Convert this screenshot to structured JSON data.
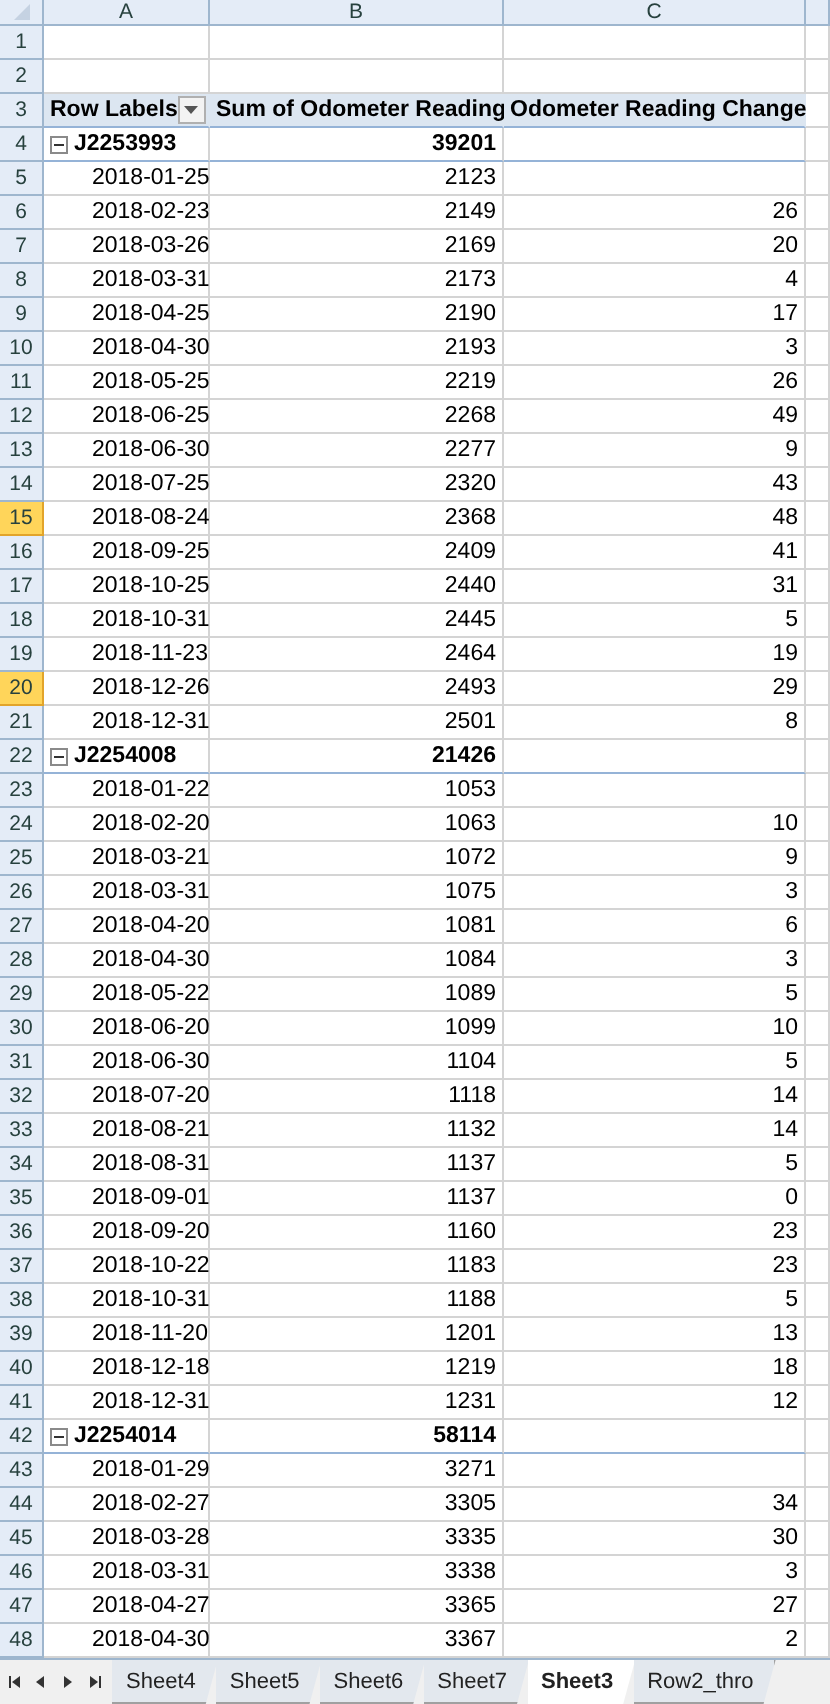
{
  "columns": [
    {
      "label": "A",
      "selected": false
    },
    {
      "label": "B",
      "selected": false
    },
    {
      "label": "C",
      "selected": false
    }
  ],
  "rows": [
    {
      "number": "1",
      "selected": false,
      "kind": "blank"
    },
    {
      "number": "2",
      "selected": false,
      "kind": "blank"
    },
    {
      "number": "3",
      "selected": false,
      "kind": "header",
      "cells": [
        "Row Labels",
        "Sum of Odometer Reading",
        "Odometer Reading Change"
      ]
    },
    {
      "number": "4",
      "selected": false,
      "kind": "group",
      "label": "J2253993",
      "sum": "39201",
      "expanded": true
    },
    {
      "number": "5",
      "selected": false,
      "kind": "item",
      "label": "2018-01-25",
      "sum": "2123"
    },
    {
      "number": "6",
      "selected": false,
      "kind": "item",
      "label": "2018-02-23",
      "sum": "2149",
      "change": "26"
    },
    {
      "number": "7",
      "selected": false,
      "kind": "item",
      "label": "2018-03-26",
      "sum": "2169",
      "change": "20"
    },
    {
      "number": "8",
      "selected": false,
      "kind": "item",
      "label": "2018-03-31",
      "sum": "2173",
      "change": "4"
    },
    {
      "number": "9",
      "selected": false,
      "kind": "item",
      "label": "2018-04-25",
      "sum": "2190",
      "change": "17"
    },
    {
      "number": "10",
      "selected": false,
      "kind": "item",
      "label": "2018-04-30",
      "sum": "2193",
      "change": "3"
    },
    {
      "number": "11",
      "selected": false,
      "kind": "item",
      "label": "2018-05-25",
      "sum": "2219",
      "change": "26"
    },
    {
      "number": "12",
      "selected": false,
      "kind": "item",
      "label": "2018-06-25",
      "sum": "2268",
      "change": "49"
    },
    {
      "number": "13",
      "selected": false,
      "kind": "item",
      "label": "2018-06-30",
      "sum": "2277",
      "change": "9"
    },
    {
      "number": "14",
      "selected": false,
      "kind": "item",
      "label": "2018-07-25",
      "sum": "2320",
      "change": "43"
    },
    {
      "number": "15",
      "selected": true,
      "kind": "item",
      "label": "2018-08-24",
      "sum": "2368",
      "change": "48"
    },
    {
      "number": "16",
      "selected": false,
      "kind": "item",
      "label": "2018-09-25",
      "sum": "2409",
      "change": "41"
    },
    {
      "number": "17",
      "selected": false,
      "kind": "item",
      "label": "2018-10-25",
      "sum": "2440",
      "change": "31"
    },
    {
      "number": "18",
      "selected": false,
      "kind": "item",
      "label": "2018-10-31",
      "sum": "2445",
      "change": "5"
    },
    {
      "number": "19",
      "selected": false,
      "kind": "item",
      "label": "2018-11-23",
      "sum": "2464",
      "change": "19"
    },
    {
      "number": "20",
      "selected": true,
      "kind": "item",
      "label": "2018-12-26",
      "sum": "2493",
      "change": "29"
    },
    {
      "number": "21",
      "selected": false,
      "kind": "item",
      "label": "2018-12-31",
      "sum": "2501",
      "change": "8"
    },
    {
      "number": "22",
      "selected": false,
      "kind": "group",
      "label": "J2254008",
      "sum": "21426",
      "expanded": true
    },
    {
      "number": "23",
      "selected": false,
      "kind": "item",
      "label": "2018-01-22",
      "sum": "1053"
    },
    {
      "number": "24",
      "selected": false,
      "kind": "item",
      "label": "2018-02-20",
      "sum": "1063",
      "change": "10"
    },
    {
      "number": "25",
      "selected": false,
      "kind": "item",
      "label": "2018-03-21",
      "sum": "1072",
      "change": "9"
    },
    {
      "number": "26",
      "selected": false,
      "kind": "item",
      "label": "2018-03-31",
      "sum": "1075",
      "change": "3"
    },
    {
      "number": "27",
      "selected": false,
      "kind": "item",
      "label": "2018-04-20",
      "sum": "1081",
      "change": "6"
    },
    {
      "number": "28",
      "selected": false,
      "kind": "item",
      "label": "2018-04-30",
      "sum": "1084",
      "change": "3"
    },
    {
      "number": "29",
      "selected": false,
      "kind": "item",
      "label": "2018-05-22",
      "sum": "1089",
      "change": "5"
    },
    {
      "number": "30",
      "selected": false,
      "kind": "item",
      "label": "2018-06-20",
      "sum": "1099",
      "change": "10"
    },
    {
      "number": "31",
      "selected": false,
      "kind": "item",
      "label": "2018-06-30",
      "sum": "1104",
      "change": "5"
    },
    {
      "number": "32",
      "selected": false,
      "kind": "item",
      "label": "2018-07-20",
      "sum": "1118",
      "change": "14"
    },
    {
      "number": "33",
      "selected": false,
      "kind": "item",
      "label": "2018-08-21",
      "sum": "1132",
      "change": "14"
    },
    {
      "number": "34",
      "selected": false,
      "kind": "item",
      "label": "2018-08-31",
      "sum": "1137",
      "change": "5"
    },
    {
      "number": "35",
      "selected": false,
      "kind": "item",
      "label": "2018-09-01",
      "sum": "1137",
      "change": "0"
    },
    {
      "number": "36",
      "selected": false,
      "kind": "item",
      "label": "2018-09-20",
      "sum": "1160",
      "change": "23"
    },
    {
      "number": "37",
      "selected": false,
      "kind": "item",
      "label": "2018-10-22",
      "sum": "1183",
      "change": "23"
    },
    {
      "number": "38",
      "selected": false,
      "kind": "item",
      "label": "2018-10-31",
      "sum": "1188",
      "change": "5"
    },
    {
      "number": "39",
      "selected": false,
      "kind": "item",
      "label": "2018-11-20",
      "sum": "1201",
      "change": "13"
    },
    {
      "number": "40",
      "selected": false,
      "kind": "item",
      "label": "2018-12-18",
      "sum": "1219",
      "change": "18"
    },
    {
      "number": "41",
      "selected": false,
      "kind": "item",
      "label": "2018-12-31",
      "sum": "1231",
      "change": "12"
    },
    {
      "number": "42",
      "selected": false,
      "kind": "group",
      "label": "J2254014",
      "sum": "58114",
      "expanded": true
    },
    {
      "number": "43",
      "selected": false,
      "kind": "item",
      "label": "2018-01-29",
      "sum": "3271"
    },
    {
      "number": "44",
      "selected": false,
      "kind": "item",
      "label": "2018-02-27",
      "sum": "3305",
      "change": "34"
    },
    {
      "number": "45",
      "selected": false,
      "kind": "item",
      "label": "2018-03-28",
      "sum": "3335",
      "change": "30"
    },
    {
      "number": "46",
      "selected": false,
      "kind": "item",
      "label": "2018-03-31",
      "sum": "3338",
      "change": "3"
    },
    {
      "number": "47",
      "selected": false,
      "kind": "item",
      "label": "2018-04-27",
      "sum": "3365",
      "change": "27"
    },
    {
      "number": "48",
      "selected": false,
      "kind": "item",
      "label": "2018-04-30",
      "sum": "3367",
      "change": "2"
    }
  ],
  "sheet_tabs": [
    {
      "label": "Sheet4",
      "selected": false
    },
    {
      "label": "Sheet5",
      "selected": false
    },
    {
      "label": "Sheet6",
      "selected": false
    },
    {
      "label": "Sheet7",
      "selected": false
    },
    {
      "label": "Sheet3",
      "selected": true
    },
    {
      "label": "Row2_thro",
      "selected": false
    }
  ]
}
